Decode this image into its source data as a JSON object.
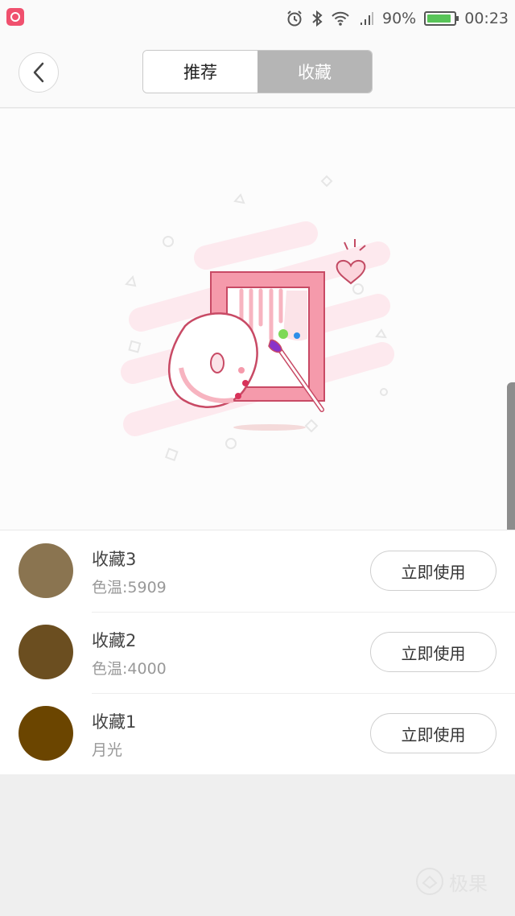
{
  "status_bar": {
    "battery_percent": "90%",
    "time": "00:23",
    "battery_level": 0.9,
    "icons": [
      "app-icon",
      "alarm-icon",
      "bluetooth-icon",
      "wifi-icon",
      "signal-icon",
      "battery-icon"
    ]
  },
  "header": {
    "tabs": [
      {
        "label": "推荐",
        "selected": true
      },
      {
        "label": "收藏",
        "selected": false
      }
    ]
  },
  "favorites": [
    {
      "title": "收藏3",
      "subtitle": "色温:5909",
      "color": "#8a7450",
      "action": "立即使用"
    },
    {
      "title": "收藏2",
      "subtitle": "色温:4000",
      "color": "#6b4e20",
      "action": "立即使用"
    },
    {
      "title": "收藏1",
      "subtitle": "月光",
      "color": "#6b4500",
      "action": "立即使用"
    }
  ],
  "watermark": {
    "text": "极果"
  },
  "colors": {
    "accent_pink": "#f07a92",
    "tab_inactive": "#b5b5b5"
  }
}
